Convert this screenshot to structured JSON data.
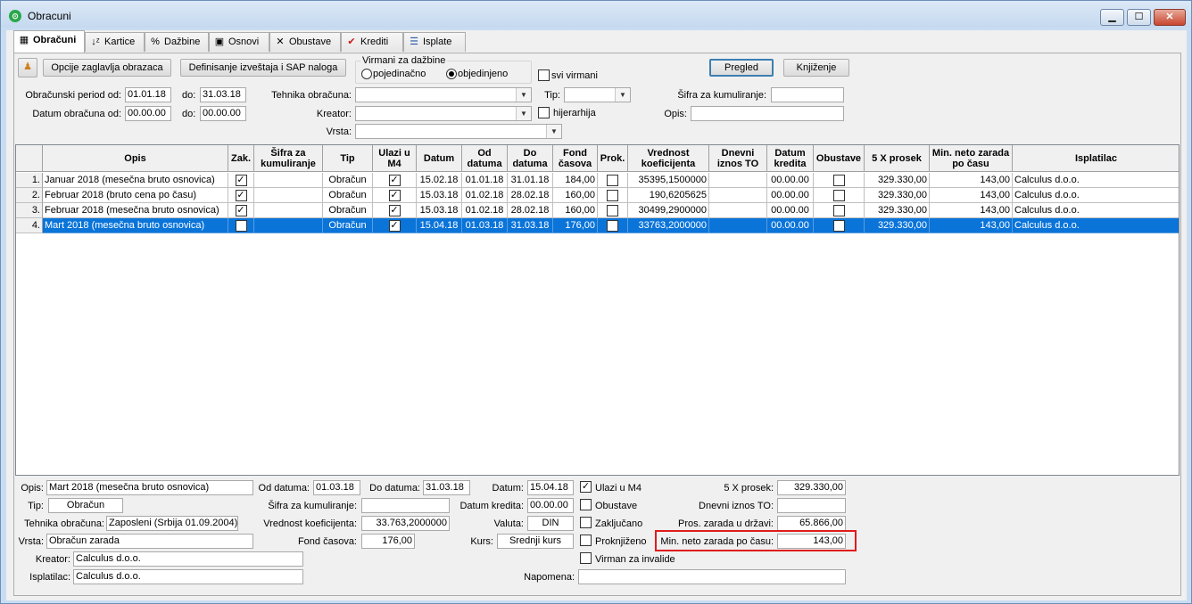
{
  "window": {
    "title": "Obracuni",
    "min": "▁",
    "max": "☐",
    "close": "✕"
  },
  "tabs": [
    {
      "label": "Obračuni",
      "icon": "table-icon"
    },
    {
      "label": "Kartice",
      "icon": "sort-icon"
    },
    {
      "label": "Dažbine",
      "icon": "percent-icon"
    },
    {
      "label": "Osnovi",
      "icon": "document-icon"
    },
    {
      "label": "Obustave",
      "icon": "x-icon"
    },
    {
      "label": "Krediti",
      "icon": "check-icon"
    },
    {
      "label": "Isplate",
      "icon": "list-icon"
    }
  ],
  "toolbar": {
    "opcije": "Opcije zaglavlja obrazaca",
    "definisanje": "Definisanje izveštaja i SAP naloga",
    "virmani_group": "Virmani za dažbine",
    "pojedinacno": "pojedinačno",
    "objedinjeno": "objedinjeno",
    "svi_virmani": "svi virmani",
    "pregled": "Pregled",
    "knjizenje": "Knjiženje"
  },
  "filters": {
    "period_od_label": "Obračunski period od:",
    "period_od": "01.01.18",
    "period_do_label": "do:",
    "period_do": "31.03.18",
    "datum_od_label": "Datum obračuna od:",
    "datum_od": "00.00.00",
    "datum_do_label": "do:",
    "datum_do": "00.00.00",
    "tehnika_label": "Tehnika obračuna:",
    "tehnika": "",
    "kreator_label": "Kreator:",
    "kreator": "",
    "vrsta_label": "Vrsta:",
    "vrsta": "",
    "tip_label": "Tip:",
    "tip": "",
    "hijerarhija": "hijerarhija",
    "sifra_label": "Šifra za kumuliranje:",
    "sifra": "",
    "opis_label": "Opis:",
    "opis": ""
  },
  "grid": {
    "headers": [
      "Opis",
      "Zak.",
      "Šifra za kumuliranje",
      "Tip",
      "Ulazi u M4",
      "Datum",
      "Od datuma",
      "Do datuma",
      "Fond časova",
      "Prok.",
      "Vrednost koeficijenta",
      "Dnevni iznos TO",
      "Datum kredita",
      "Obustave",
      "5 X prosek",
      "Min. neto zarada po času",
      "Isplatilac"
    ],
    "rows": [
      {
        "num": "1.",
        "opis": "Januar 2018 (mesečna bruto osnovica)",
        "zak": "✓",
        "sifra": "",
        "tip": "Obračun",
        "m4": "✓",
        "datum": "15.02.18",
        "od": "01.01.18",
        "do": "31.01.18",
        "fond": "184,00",
        "prok": "",
        "koef": "35395,1500000",
        "dnevni": "",
        "kredit": "00.00.00",
        "obustave": "",
        "prosek": "329.330,00",
        "minneto": "143,00",
        "isplatilac": "Calculus d.o.o."
      },
      {
        "num": "2.",
        "opis": "Februar 2018 (bruto cena po času)",
        "zak": "✓",
        "sifra": "",
        "tip": "Obračun",
        "m4": "✓",
        "datum": "15.03.18",
        "od": "01.02.18",
        "do": "28.02.18",
        "fond": "160,00",
        "prok": "",
        "koef": "190,6205625",
        "dnevni": "",
        "kredit": "00.00.00",
        "obustave": "",
        "prosek": "329.330,00",
        "minneto": "143,00",
        "isplatilac": "Calculus d.o.o."
      },
      {
        "num": "3.",
        "opis": "Februar 2018 (mesečna bruto osnovica)",
        "zak": "✓",
        "sifra": "",
        "tip": "Obračun",
        "m4": "✓",
        "datum": "15.03.18",
        "od": "01.02.18",
        "do": "28.02.18",
        "fond": "160,00",
        "prok": "",
        "koef": "30499,2900000",
        "dnevni": "",
        "kredit": "00.00.00",
        "obustave": "",
        "prosek": "329.330,00",
        "minneto": "143,00",
        "isplatilac": "Calculus d.o.o."
      },
      {
        "num": "4.",
        "opis": "Mart 2018 (mesečna bruto osnovica)",
        "zak": "",
        "sifra": "",
        "tip": "Obračun",
        "m4": "✓",
        "datum": "15.04.18",
        "od": "01.03.18",
        "do": "31.03.18",
        "fond": "176,00",
        "prok": "",
        "koef": "33763,2000000",
        "dnevni": "",
        "kredit": "00.00.00",
        "obustave": "",
        "prosek": "329.330,00",
        "minneto": "143,00",
        "isplatilac": "Calculus d.o.o."
      }
    ]
  },
  "detail": {
    "opis_label": "Opis:",
    "opis": "Mart 2018 (mesečna bruto osnovica)",
    "od_label": "Od datuma:",
    "od": "01.03.18",
    "do_label": "Do datuma:",
    "do": "31.03.18",
    "datum_label": "Datum:",
    "datum": "15.04.18",
    "m4": "Ulazi u M4",
    "prosek_label": "5 X prosek:",
    "prosek": "329.330,00",
    "tip_label": "Tip:",
    "tip": "Obračun",
    "sifra_label": "Šifra za kumuliranje:",
    "sifra": "",
    "kredit_label": "Datum kredita:",
    "kredit": "00.00.00",
    "obustave": "Obustave",
    "dnevni_label": "Dnevni iznos TO:",
    "dnevni": "",
    "tehnika_label": "Tehnika obračuna:",
    "tehnika": "Zaposleni (Srbija 01.09.2004)",
    "koef_label": "Vrednost koeficijenta:",
    "koef": "33.763,2000000",
    "valuta_label": "Valuta:",
    "valuta": "DIN",
    "zakljucano": "Zaključano",
    "pros_label": "Pros. zarada u državi:",
    "pros": "65.866,00",
    "vrsta_label": "Vrsta:",
    "vrsta": "Obračun zarada",
    "fond_label": "Fond časova:",
    "fond": "176,00",
    "kurs_label": "Kurs:",
    "kurs": "Srednji kurs",
    "proknjizeno": "Proknjiženo",
    "minneto_label": "Min. neto zarada po času:",
    "minneto": "143,00",
    "kreator_label": "Kreator:",
    "kreator": "Calculus d.o.o.",
    "invalide": "Virman za invalide",
    "isplatilac_label": "Isplatilac:",
    "isplatilac": "Calculus d.o.o.",
    "napomena_label": "Napomena:",
    "napomena": ""
  },
  "colors": {
    "selection": "#0a74d9",
    "highlight": "#e01b1b"
  }
}
